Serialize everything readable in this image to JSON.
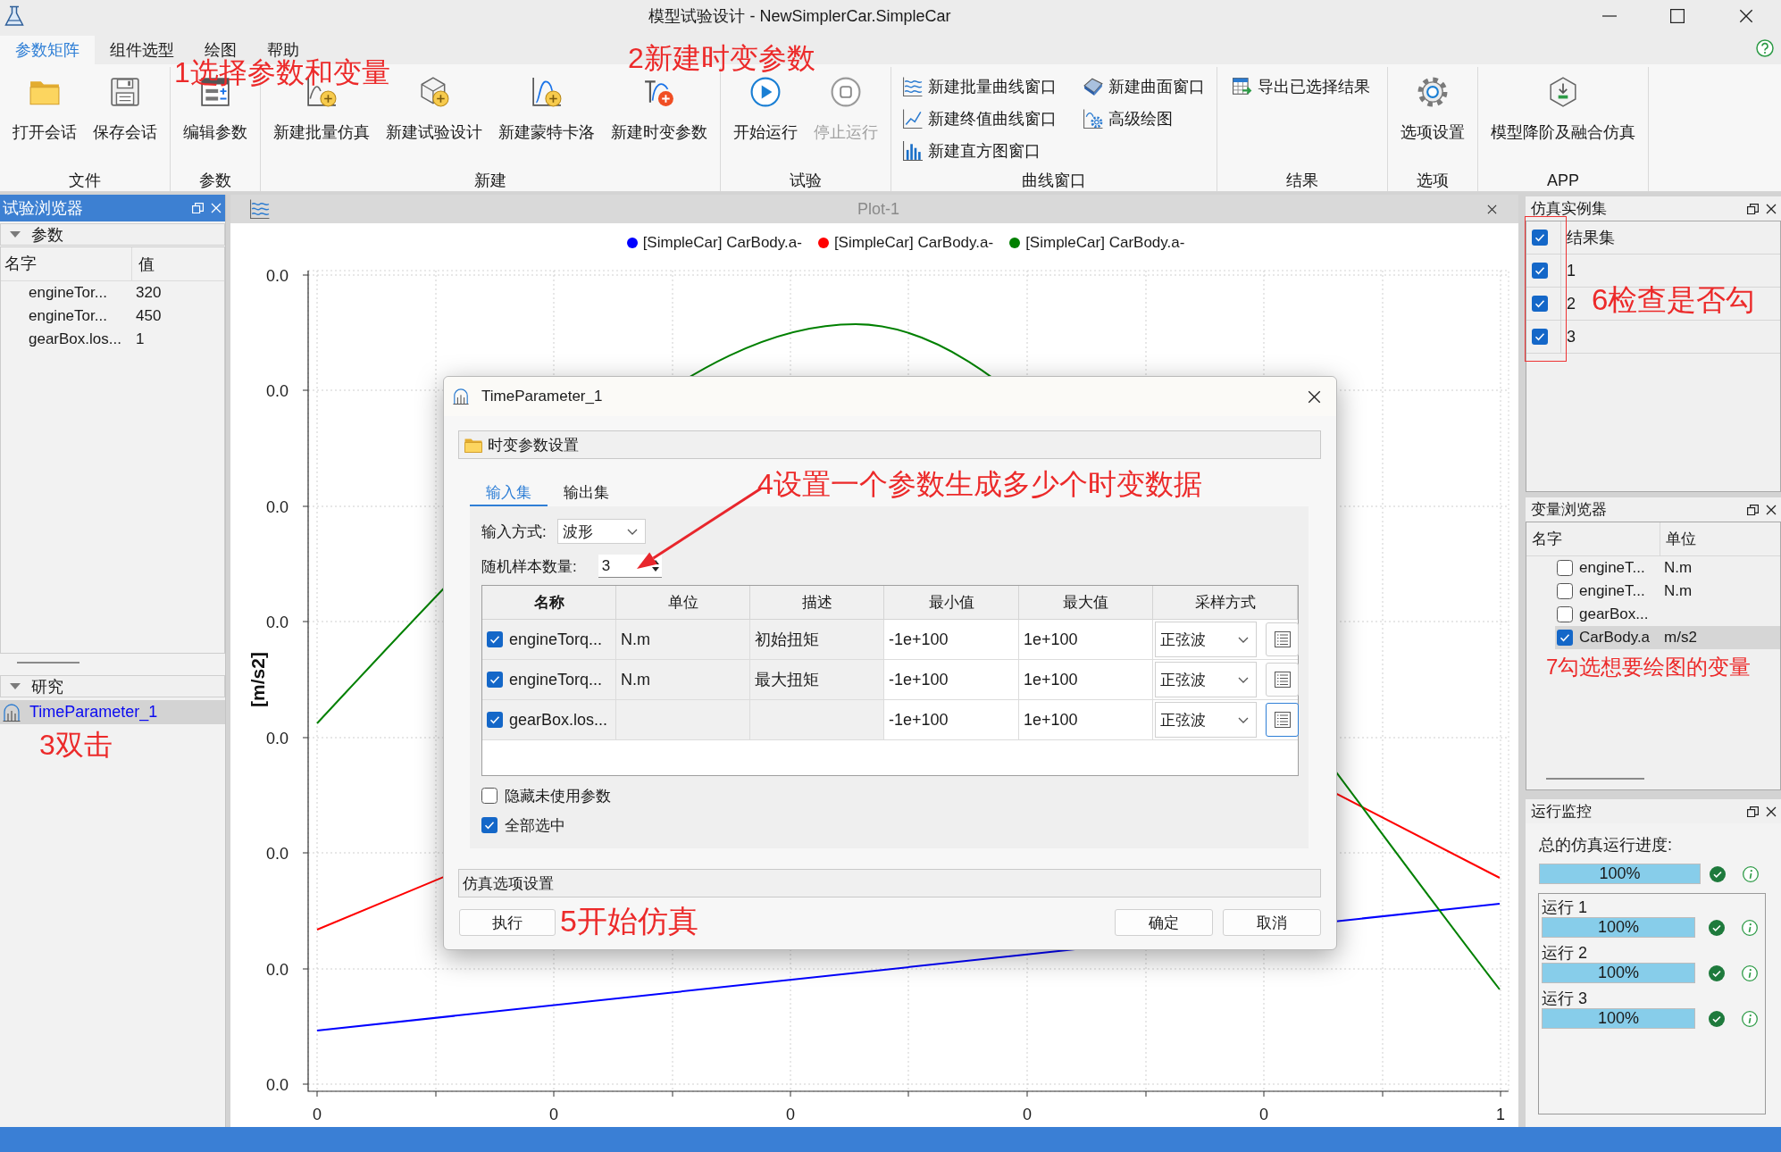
{
  "window": {
    "title": "模型试验设计 - NewSimplerCar.SimpleCar"
  },
  "ribbon": {
    "tabs": [
      {
        "label": "参数矩阵",
        "selected": true
      },
      {
        "label": "组件选型",
        "selected": false
      },
      {
        "label": "绘图",
        "selected": false
      },
      {
        "label": "帮助",
        "selected": false
      }
    ],
    "groups": [
      {
        "label": "文件",
        "kind": "large",
        "buttons": [
          {
            "label": "打开会话",
            "disabled": false
          },
          {
            "label": "保存会话",
            "disabled": false
          }
        ]
      },
      {
        "label": "参数",
        "kind": "large",
        "buttons": [
          {
            "label": "编辑参数",
            "disabled": false
          }
        ]
      },
      {
        "label": "新建",
        "kind": "large",
        "buttons": [
          {
            "label": "新建批量仿真",
            "disabled": false
          },
          {
            "label": "新建试验设计",
            "disabled": false
          },
          {
            "label": "新建蒙特卡洛",
            "disabled": false
          },
          {
            "label": "新建时变参数",
            "disabled": false
          }
        ]
      },
      {
        "label": "试验",
        "kind": "large",
        "buttons": [
          {
            "label": "开始运行",
            "disabled": false
          },
          {
            "label": "停止运行",
            "disabled": true
          }
        ]
      },
      {
        "label": "曲线窗口",
        "kind": "small",
        "buttons": [
          {
            "label": "新建批量曲线窗口",
            "disabled": false
          },
          {
            "label": "新建曲面窗口",
            "disabled": false
          },
          {
            "label": "新建终值曲线窗口",
            "disabled": false
          },
          {
            "label": "高级绘图",
            "disabled": false
          },
          {
            "label": "新建直方图窗口",
            "disabled": false
          }
        ]
      },
      {
        "label": "结果",
        "kind": "small",
        "buttons": [
          {
            "label": "导出已选择结果",
            "disabled": false
          }
        ]
      },
      {
        "label": "选项",
        "kind": "large",
        "buttons": [
          {
            "label": "选项设置",
            "disabled": false
          }
        ]
      },
      {
        "label": "APP",
        "kind": "large",
        "buttons": [
          {
            "label": "模型降阶及融合仿真",
            "disabled": false
          }
        ]
      }
    ],
    "annotations": [
      "1选择参数和变量",
      "2新建时变参数"
    ]
  },
  "experiment_browser": {
    "title": "试验浏览器",
    "parameters": {
      "label": "参数",
      "expanded": true,
      "columns": [
        "名字",
        "值"
      ],
      "rows": [
        [
          "engineTor...",
          "320"
        ],
        [
          "engineTor...",
          "450"
        ],
        [
          "gearBox.los...",
          "1"
        ]
      ]
    },
    "studies": {
      "label": "研究",
      "expanded": true,
      "items": [
        {
          "label": "TimeParameter_1",
          "selected": true
        }
      ]
    },
    "annotation": "3双击"
  },
  "plot": {
    "title": "Plot-1",
    "legend": [
      {
        "label": "[SimpleCar] CarBody.a-",
        "color": "#0000ff"
      },
      {
        "label": "[SimpleCar] CarBody.a-",
        "color": "#ff0000"
      },
      {
        "label": "[SimpleCar] CarBody.a-",
        "color": "#008000"
      }
    ],
    "ylabel": "[m/s2]",
    "y_tick_labels": [
      "0.0",
      "0.0",
      "0.0",
      "0.0",
      "0.0",
      "0.0",
      "0.0",
      "0.0"
    ],
    "x_tick_labels": [
      "0",
      "0",
      "0",
      "0",
      "0",
      "1"
    ]
  },
  "dialog": {
    "title": "TimeParameter_1",
    "settings_section": "时变参数设置",
    "tabs": [
      {
        "label": "输入集",
        "selected": true
      },
      {
        "label": "输出集",
        "selected": false
      }
    ],
    "input_mode": {
      "label": "输入方式:",
      "value": "波形"
    },
    "sample_count": {
      "label": "随机样本数量:",
      "value": "3"
    },
    "table": {
      "columns": [
        "名称",
        "单位",
        "描述",
        "最小值",
        "最大值",
        "采样方式"
      ],
      "rows": [
        {
          "checked": true,
          "name": "engineTorq...",
          "unit": "N.m",
          "description": "初始扭矩",
          "min": "-1e+100",
          "max": "1e+100",
          "sampling": "正弦波",
          "focused": false
        },
        {
          "checked": true,
          "name": "engineTorq...",
          "unit": "N.m",
          "description": "最大扭矩",
          "min": "-1e+100",
          "max": "1e+100",
          "sampling": "正弦波",
          "focused": false
        },
        {
          "checked": true,
          "name": "gearBox.los...",
          "min": "-1e+100",
          "max": "1e+100",
          "sampling": "正弦波",
          "focused": true
        }
      ]
    },
    "options": [
      {
        "label": "隐藏未使用参数",
        "checked": false
      },
      {
        "label": "全部选中",
        "checked": true
      }
    ],
    "simulation_section": "仿真选项设置",
    "buttons": [
      "执行",
      "确定",
      "取消"
    ],
    "annotation": "4设置一个参数生成多少个时变数据",
    "run_annotation": "5开始仿真"
  },
  "instance_set": {
    "title": "仿真实例集",
    "items": [
      {
        "label": "结果集",
        "checked": true
      },
      {
        "label": "1",
        "checked": true
      },
      {
        "label": "2",
        "checked": true
      },
      {
        "label": "3",
        "checked": true
      }
    ],
    "annotation": "6检查是否勾"
  },
  "variable_browser": {
    "title": "变量浏览器",
    "columns": [
      "名字",
      "单位"
    ],
    "rows": [
      {
        "name": "engineT...",
        "unit": "N.m",
        "checked": false,
        "selected": false
      },
      {
        "name": "engineT...",
        "unit": "N.m",
        "checked": false,
        "selected": false
      },
      {
        "name": "gearBox...",
        "checked": false,
        "selected": false
      },
      {
        "name": "CarBody.a",
        "unit": "m/s2",
        "checked": true,
        "selected": true
      }
    ],
    "annotation": "7勾选想要绘图的变量"
  },
  "run_monitor": {
    "title": "运行监控",
    "total": {
      "label": "总的仿真运行进度:",
      "level": 1,
      "reading": "100%",
      "done": true
    },
    "runs": [
      {
        "label": "运行 1",
        "level": 1,
        "reading": "100%",
        "done": true
      },
      {
        "label": "运行 2",
        "level": 1,
        "reading": "100%",
        "done": true
      },
      {
        "label": "运行 3",
        "level": 1,
        "reading": "100%",
        "done": true
      }
    ]
  }
}
